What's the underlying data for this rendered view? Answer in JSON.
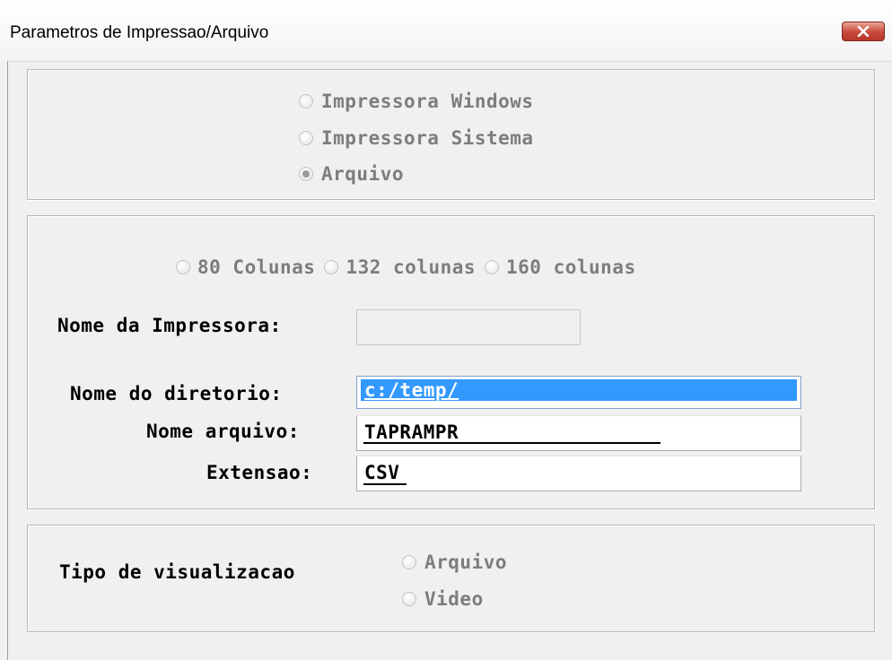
{
  "window": {
    "title": "Parametros de Impressao/Arquivo",
    "close_icon": "close-icon"
  },
  "output_type": {
    "options": [
      "Impressora Windows",
      "Impressora Sistema",
      "Arquivo"
    ],
    "selected": "Arquivo"
  },
  "columns": {
    "options": [
      "80 Colunas",
      "132 colunas",
      "160 colunas"
    ],
    "selected": null
  },
  "fields": {
    "printer_name_label": "Nome da Impressora:",
    "printer_name_value": "",
    "directory_label": "Nome do diretorio:",
    "directory_value": "c:/temp/",
    "filename_label": "Nome arquivo:",
    "filename_value": "TAPRAMPR",
    "extension_label": "Extensao:",
    "extension_value": "CSV"
  },
  "view_type": {
    "label": "Tipo de visualizacao",
    "options": [
      "Arquivo",
      "Video"
    ],
    "selected": null
  },
  "colors": {
    "selection": "#3399ff",
    "disabled_text": "#7d7d7d",
    "close_button": "#c9483b"
  }
}
